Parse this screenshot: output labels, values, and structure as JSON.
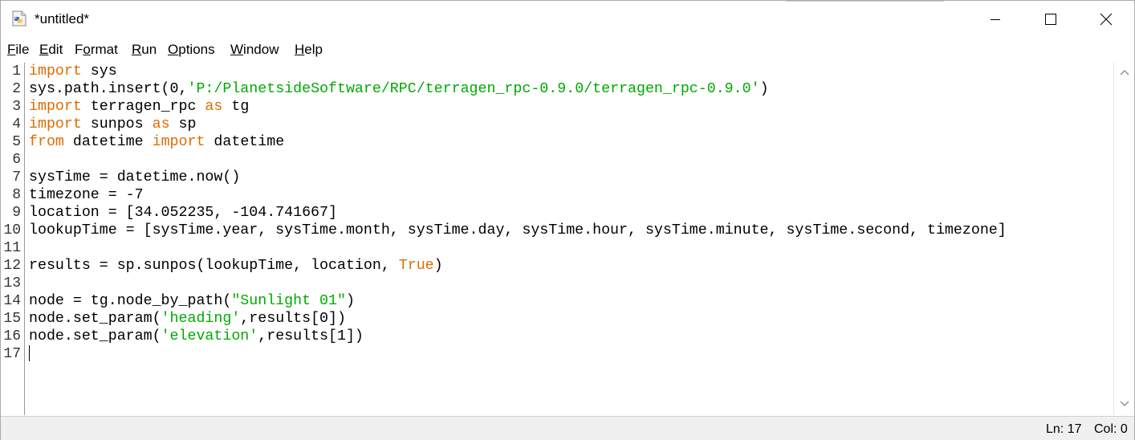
{
  "window": {
    "title": "*untitled*",
    "icon": "python-idle-icon"
  },
  "window_controls": {
    "minimize": "minimize-icon",
    "maximize": "maximize-icon",
    "close": "close-icon"
  },
  "menu": {
    "items": [
      {
        "key": "F",
        "rest": "ile"
      },
      {
        "key": "E",
        "rest": "dit"
      },
      {
        "pre": "F",
        "key": "o",
        "rest": "rmat"
      },
      {
        "key": "R",
        "rest": "un"
      },
      {
        "key": "O",
        "rest": "ptions"
      },
      {
        "key": "W",
        "rest": "indow"
      },
      {
        "key": "H",
        "rest": "elp"
      }
    ]
  },
  "editor": {
    "line_numbers": [
      "1",
      "2",
      "3",
      "4",
      "5",
      "6",
      "7",
      "8",
      "9",
      "10",
      "11",
      "12",
      "13",
      "14",
      "15",
      "16",
      "17"
    ],
    "lines": [
      [
        {
          "t": "import",
          "c": "kw"
        },
        {
          "t": " sys"
        }
      ],
      [
        {
          "t": "sys.path.insert(0,"
        },
        {
          "t": "'P:/PlanetsideSoftware/RPC/terragen_rpc-0.9.0/terragen_rpc-0.9.0'",
          "c": "str"
        },
        {
          "t": ")"
        }
      ],
      [
        {
          "t": "import",
          "c": "kw"
        },
        {
          "t": " terragen_rpc "
        },
        {
          "t": "as",
          "c": "kw"
        },
        {
          "t": " tg"
        }
      ],
      [
        {
          "t": "import",
          "c": "kw"
        },
        {
          "t": " sunpos "
        },
        {
          "t": "as",
          "c": "kw"
        },
        {
          "t": " sp"
        }
      ],
      [
        {
          "t": "from",
          "c": "kw"
        },
        {
          "t": " datetime "
        },
        {
          "t": "import",
          "c": "kw"
        },
        {
          "t": " datetime"
        }
      ],
      [],
      [
        {
          "t": "sysTime = datetime.now()"
        }
      ],
      [
        {
          "t": "timezone = -7"
        }
      ],
      [
        {
          "t": "location = [34.052235, -104.741667]"
        }
      ],
      [
        {
          "t": "lookupTime = [sysTime.year, sysTime.month, sysTime.day, sysTime.hour, sysTime.minute, sysTime.second, timezone]"
        }
      ],
      [],
      [
        {
          "t": "results = sp.sunpos(lookupTime, location, "
        },
        {
          "t": "True",
          "c": "kw"
        },
        {
          "t": ")"
        }
      ],
      [],
      [
        {
          "t": "node = tg.node_by_path("
        },
        {
          "t": "\"Sunlight 01\"",
          "c": "str"
        },
        {
          "t": ")"
        }
      ],
      [
        {
          "t": "node.set_param("
        },
        {
          "t": "'heading'",
          "c": "str"
        },
        {
          "t": ",results[0])"
        }
      ],
      [
        {
          "t": "node.set_param("
        },
        {
          "t": "'elevation'",
          "c": "str"
        },
        {
          "t": ",results[1])"
        }
      ],
      []
    ]
  },
  "colors": {
    "keyword": "#e06c00",
    "string": "#00aa00"
  },
  "status": {
    "line": "Ln: 17",
    "column": "Col: 0"
  }
}
